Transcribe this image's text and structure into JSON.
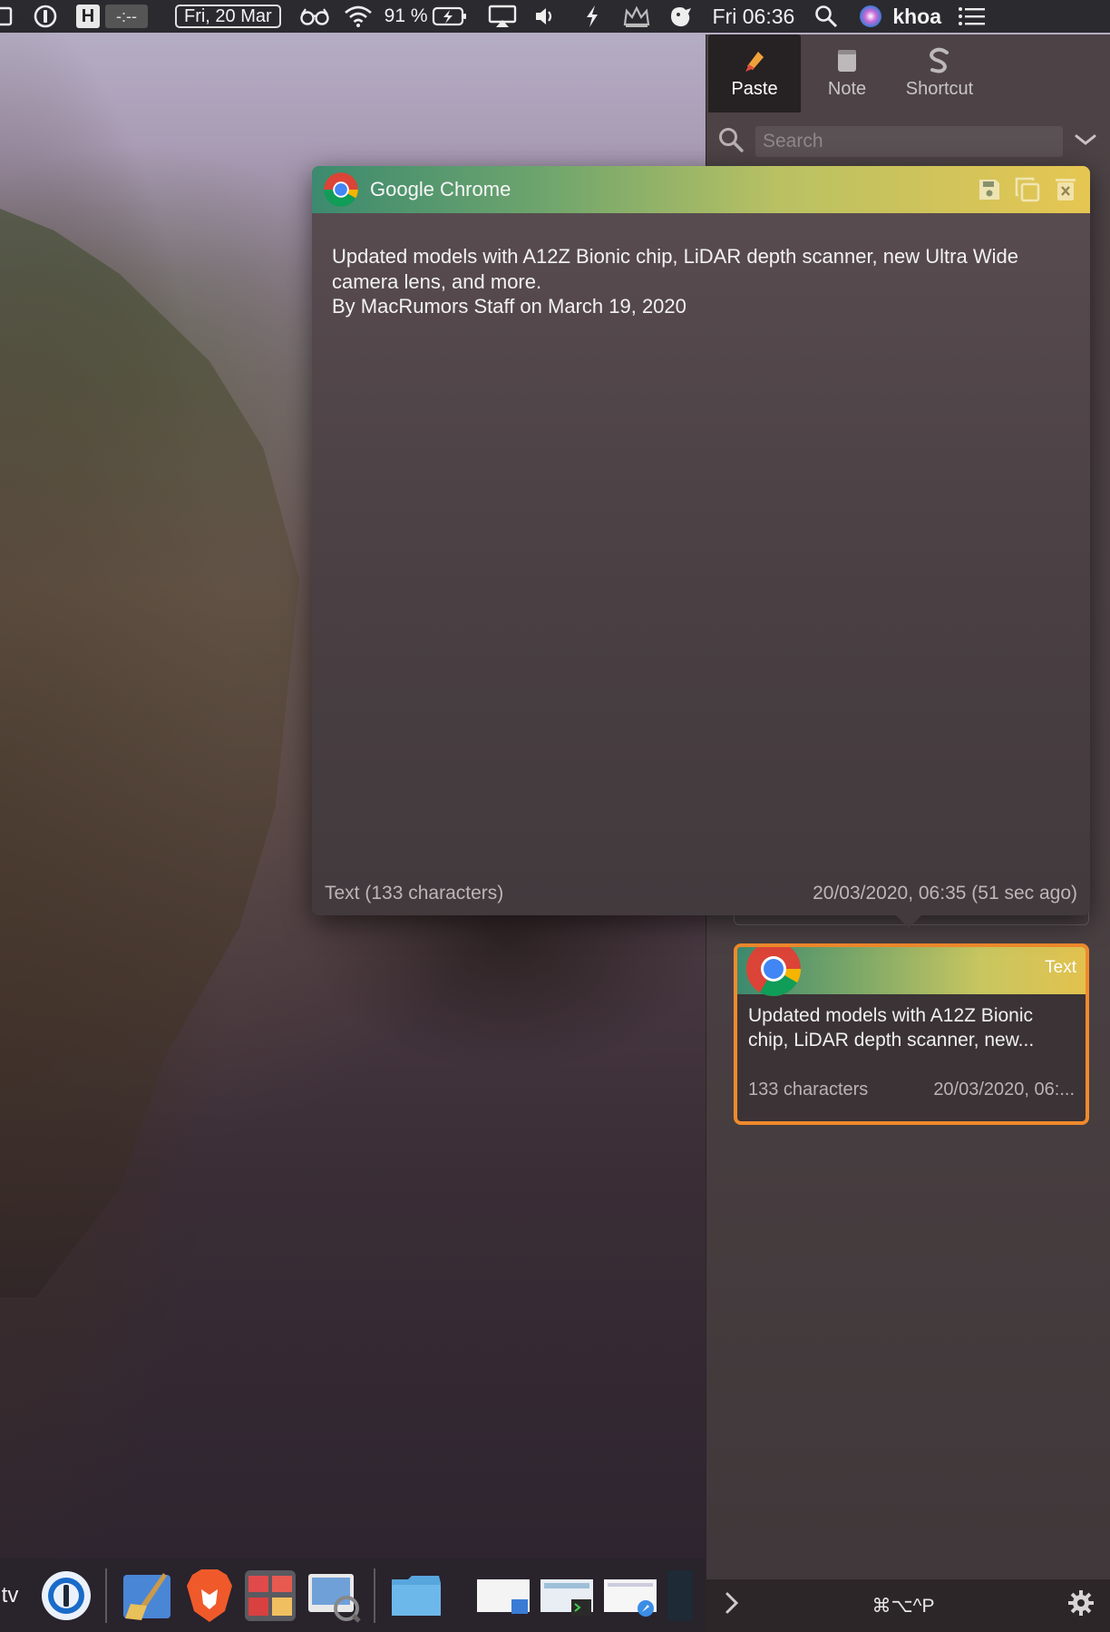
{
  "menubar": {
    "h_label": "H",
    "timer_label": "-:--",
    "date_label": "Fri, 20 Mar",
    "battery_label": "91 %",
    "clock_label": "Fri 06:36",
    "user_label": "khoa"
  },
  "panel": {
    "tabs": [
      {
        "label": "Paste",
        "icon": "paste-icon"
      },
      {
        "label": "Note",
        "icon": "note-icon"
      },
      {
        "label": "Shortcut",
        "icon": "shortcut-icon"
      }
    ],
    "search": {
      "placeholder": "Search",
      "value": ""
    },
    "clip": {
      "type_label": "Text",
      "text": "Updated models with A12Z Bionic chip, LiDAR depth scanner, new...",
      "chars_label": "133 characters",
      "time_label": "20/03/2020, 06:..."
    },
    "shortcut_label": "⌘⌥^P"
  },
  "popup": {
    "app_name": "Google Chrome",
    "content_line1": "Updated models with A12Z Bionic chip, LiDAR depth scanner, new Ultra Wide camera lens, and more.",
    "content_line2": "By MacRumors Staff on March 19, 2020",
    "type_info": "Text (133 characters)",
    "timestamp": "20/03/2020, 06:35 (51 sec ago)"
  },
  "dock": {
    "tv_label": "tv"
  },
  "colors": {
    "accent_orange": "#f08a2c",
    "panel_bg": "#4b4144",
    "tab_active_bg": "#262123",
    "header_gradient_start": "#3c8a6f",
    "header_gradient_end": "#e6c652"
  }
}
